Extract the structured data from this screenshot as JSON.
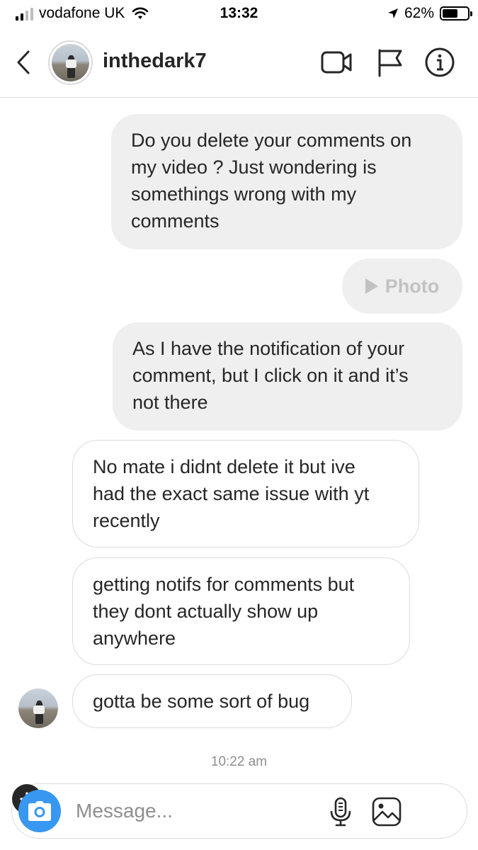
{
  "status_bar": {
    "carrier": "vodafone UK",
    "time": "13:32",
    "battery_percent": "62%",
    "battery_level": 0.62,
    "signal_bars": 2,
    "icons": [
      "signal-icon",
      "wifi-icon",
      "location-arrow-icon",
      "battery-icon"
    ]
  },
  "header": {
    "username": "inthedark7",
    "icons": [
      "back-chevron-icon",
      "video-call-icon",
      "flag-icon",
      "info-icon"
    ]
  },
  "messages": [
    {
      "direction": "outgoing",
      "type": "text",
      "lines": [
        "Do you delete your comments on",
        "my video ? Just wondering is",
        "somethings wrong with my",
        "comments"
      ]
    },
    {
      "direction": "outgoing",
      "type": "photo",
      "label": "Photo"
    },
    {
      "direction": "outgoing",
      "type": "text",
      "lines": [
        "As I have the notification of your",
        "comment, but I click on it and it’s",
        "not there"
      ]
    },
    {
      "direction": "incoming",
      "type": "text",
      "lines": [
        "No mate i didnt delete it but ive",
        "had the exact same issue with yt",
        "recently"
      ]
    },
    {
      "direction": "incoming",
      "type": "text",
      "lines": [
        "getting notifs for comments but",
        "they dont actually show up",
        "anywhere"
      ]
    },
    {
      "direction": "incoming",
      "type": "text",
      "lines": [
        "gotta be some sort of bug"
      ]
    }
  ],
  "timestamp": "10:22 am",
  "composer": {
    "placeholder": "Message...",
    "value": "",
    "icons": [
      "camera-icon",
      "microphone-icon",
      "gallery-icon",
      "plus-icon"
    ]
  },
  "colors": {
    "camera_button": "#3897f0",
    "outgoing_bubble": "#efefef",
    "incoming_border": "#dbdbdb",
    "text": "#262626",
    "muted": "#8e8e8e"
  }
}
